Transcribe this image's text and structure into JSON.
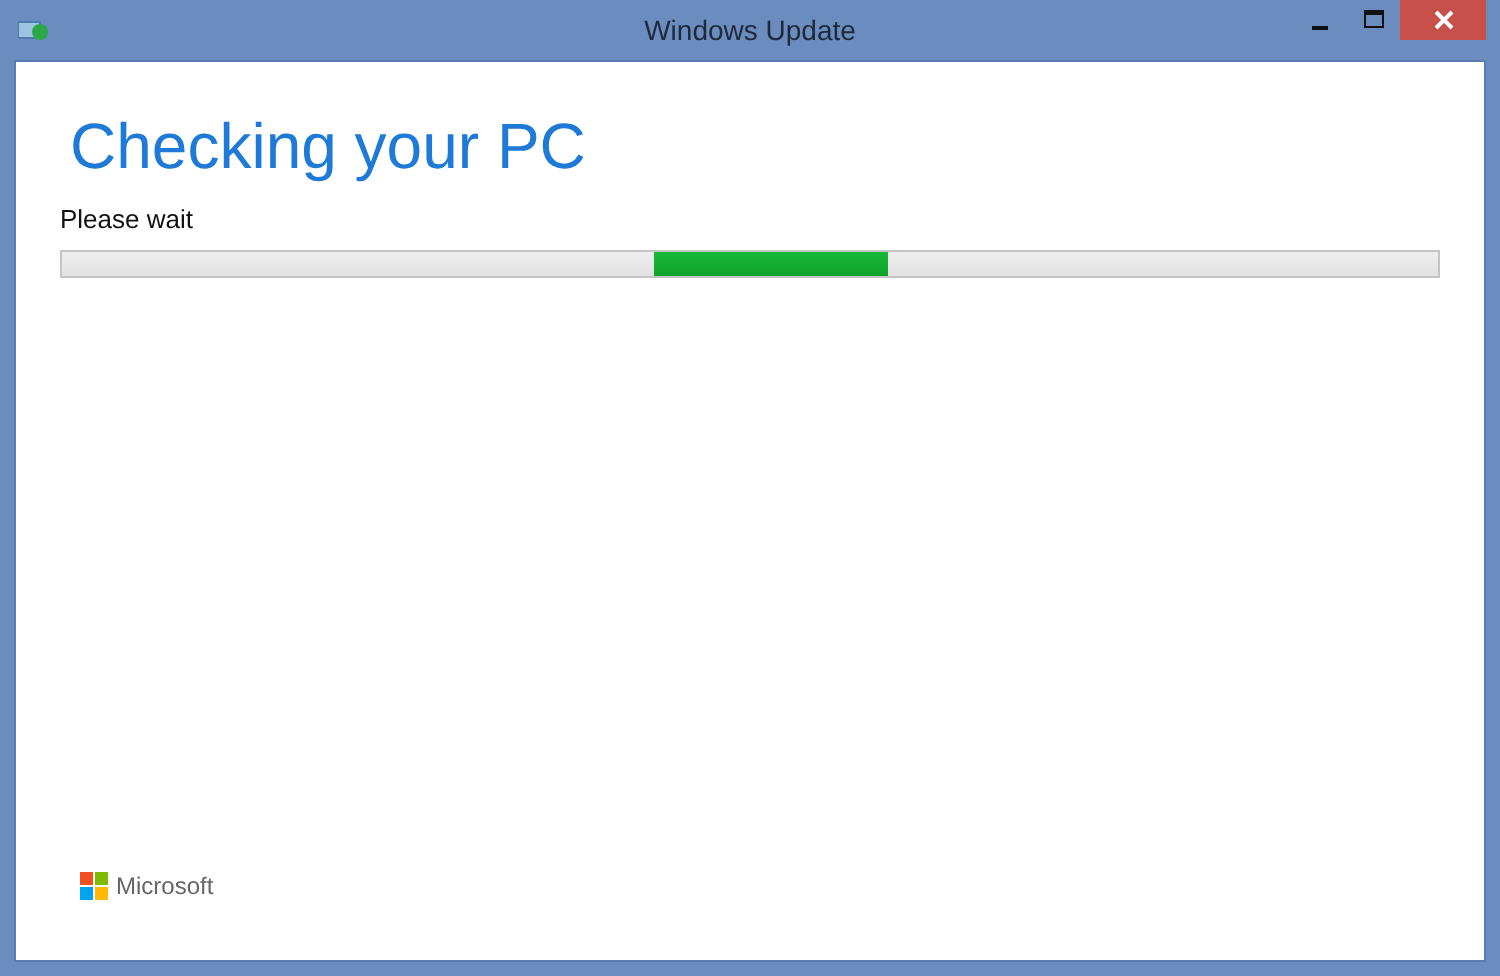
{
  "window": {
    "title": "Windows Update"
  },
  "heading": "Checking your PC",
  "status": "Please wait",
  "footer": {
    "brand": "Microsoft"
  }
}
